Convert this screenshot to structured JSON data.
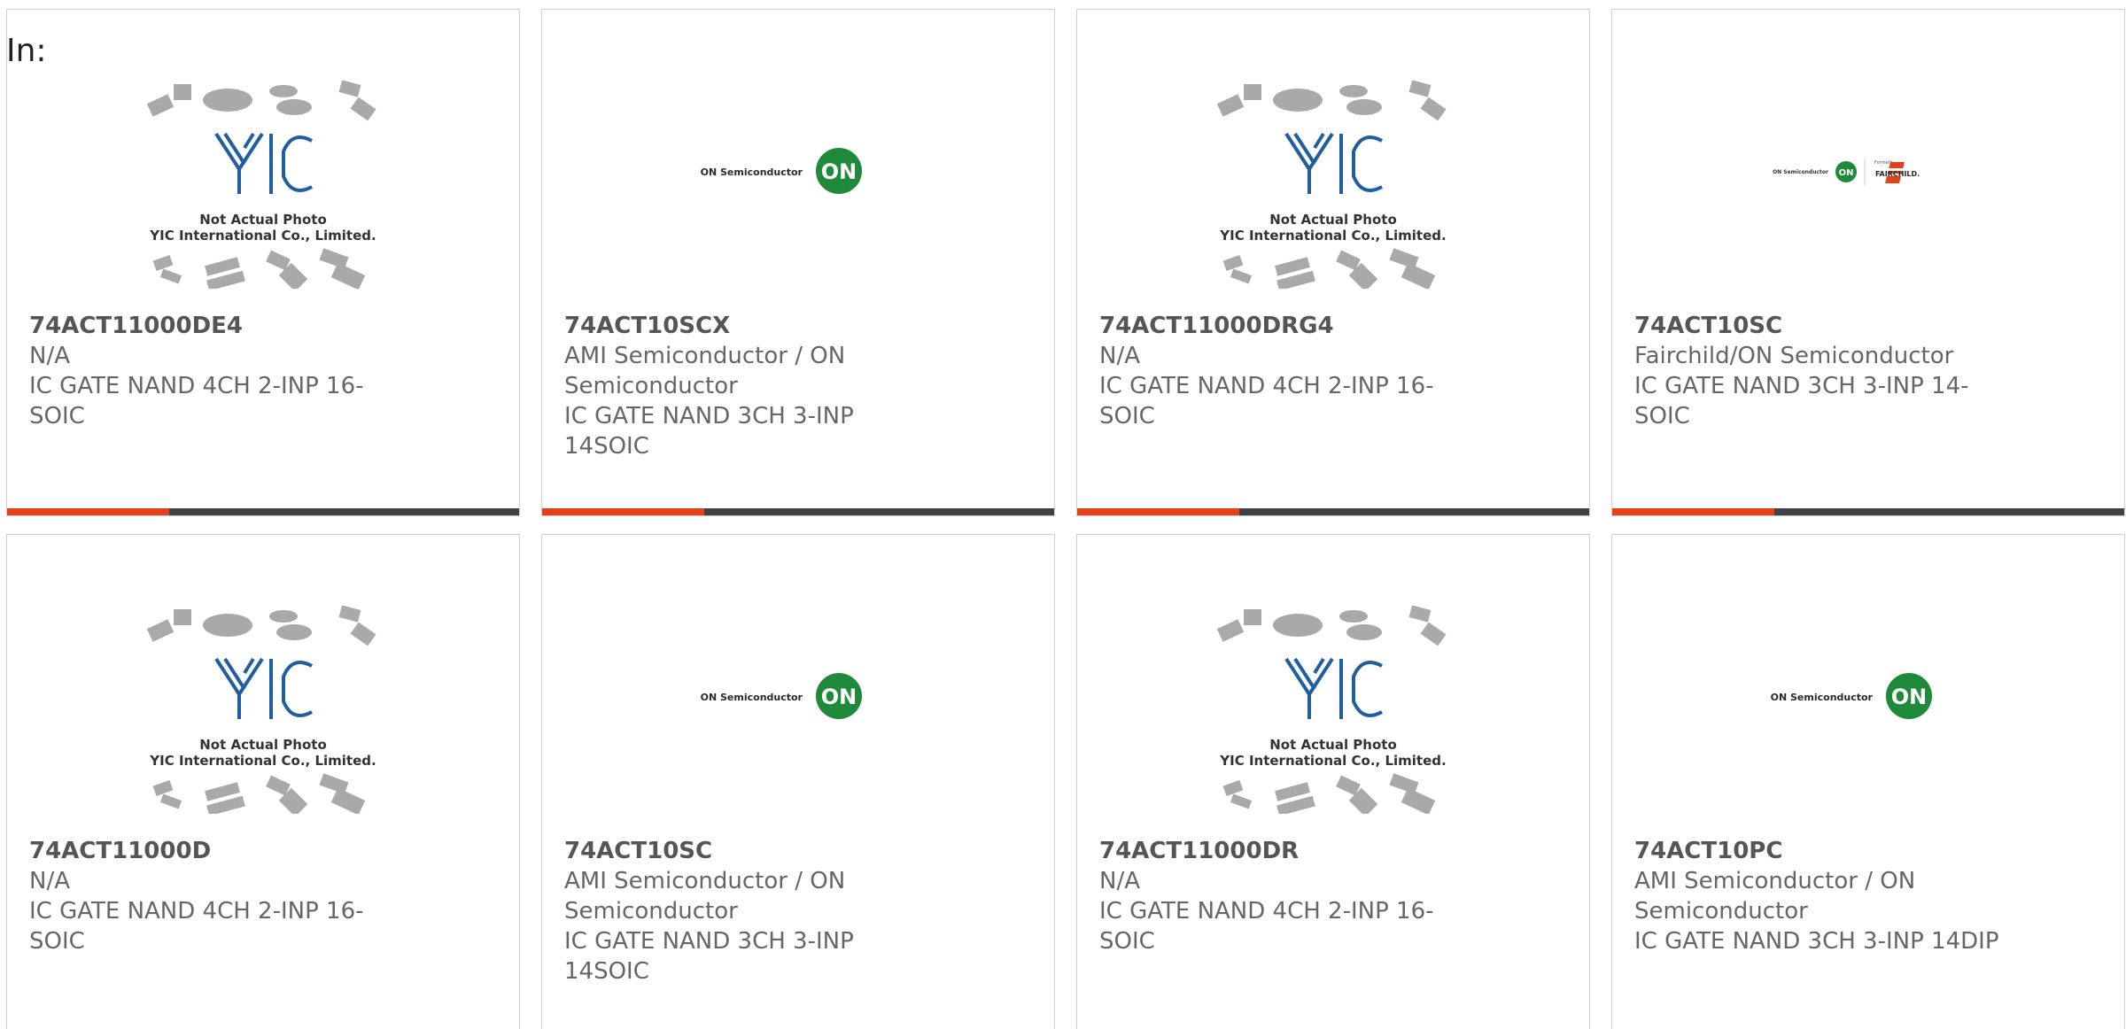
{
  "heading": "In:",
  "accent_color": "#e4401b",
  "bar_color": "#3f4243",
  "yic_photo": {
    "line1": "Not Actual Photo",
    "line2": "YIC International Co., Limited."
  },
  "on_logo": {
    "text": "ON Semiconductor",
    "mark": "ON"
  },
  "fairchild_logo": {
    "on_text": "ON Semiconductor",
    "mark": "ON",
    "formerly": "Formerly",
    "brand": "FAIRCHILD."
  },
  "products": [
    {
      "part": "74ACT11000DE4",
      "manufacturer": "N/A",
      "description": "IC GATE NAND 4CH 2-INP 16-SOIC",
      "image": "yic"
    },
    {
      "part": "74ACT10SCX",
      "manufacturer": "AMI Semiconductor / ON Semiconductor",
      "description": "IC GATE NAND 3CH 3-INP 14SOIC",
      "image": "on"
    },
    {
      "part": "74ACT11000DRG4",
      "manufacturer": "N/A",
      "description": "IC GATE NAND 4CH 2-INP 16-SOIC",
      "image": "yic"
    },
    {
      "part": "74ACT10SC",
      "manufacturer": "Fairchild/ON Semiconductor",
      "description": "IC GATE NAND 3CH 3-INP 14-SOIC",
      "image": "fairchild"
    },
    {
      "part": "74ACT11000D",
      "manufacturer": "N/A",
      "description": "IC GATE NAND 4CH 2-INP 16-SOIC",
      "image": "yic"
    },
    {
      "part": "74ACT10SC",
      "manufacturer": "AMI Semiconductor / ON Semiconductor",
      "description": "IC GATE NAND 3CH 3-INP 14SOIC",
      "image": "on"
    },
    {
      "part": "74ACT11000DR",
      "manufacturer": "N/A",
      "description": "IC GATE NAND 4CH 2-INP 16-SOIC",
      "image": "yic"
    },
    {
      "part": "74ACT10PC",
      "manufacturer": "AMI Semiconductor / ON Semiconductor",
      "description": "IC GATE NAND 3CH 3-INP 14DIP",
      "image": "on"
    }
  ]
}
